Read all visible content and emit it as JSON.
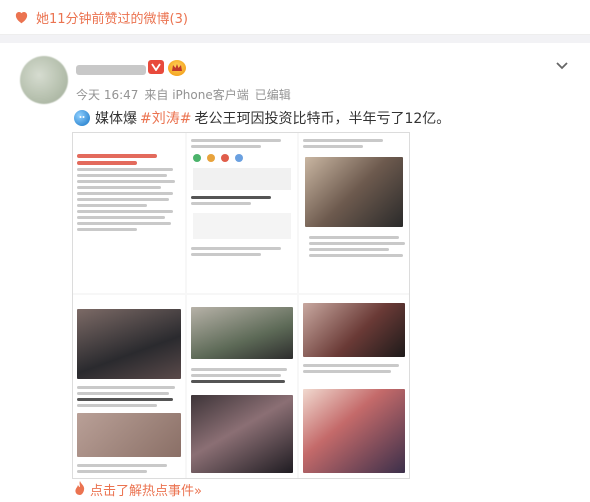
{
  "header": {
    "title": "她11分钟前赞过的微博(3)"
  },
  "post": {
    "time": "今天 16:47",
    "source": "来自 iPhone客户端",
    "edited": "已编辑",
    "text_prefix": "媒体爆",
    "hashtag": "#刘涛#",
    "text_rest": "老公王珂因投资比特币，半年亏了12亿。"
  },
  "hot_link": {
    "label": "点击了解热点事件»"
  },
  "colors": {
    "accent": "#eb7350",
    "meta": "#939393"
  }
}
